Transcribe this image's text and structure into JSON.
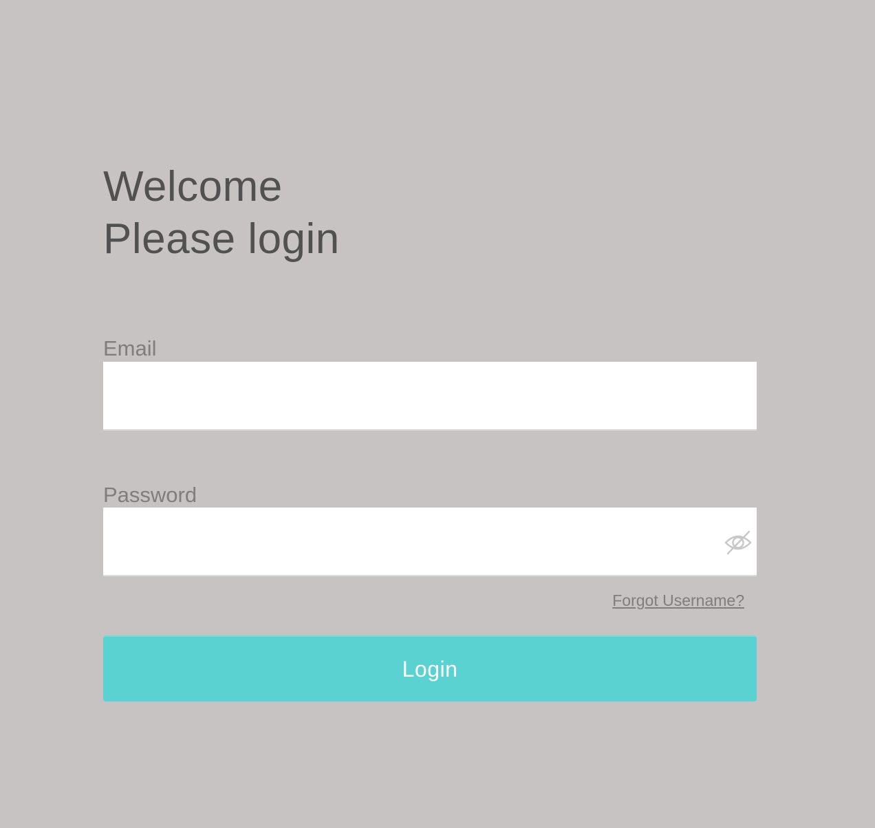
{
  "header": {
    "line1": "Welcome",
    "line2": "Please login"
  },
  "form": {
    "email": {
      "label": "Email",
      "value": "",
      "placeholder": ""
    },
    "password": {
      "label": "Password",
      "value": "",
      "placeholder": "",
      "toggle_icon": "eye-slash-icon"
    },
    "forgot_username_label": "Forgot Username?",
    "login_label": "Login"
  },
  "colors": {
    "background": "#c6c3c2",
    "heading_text": "#525151",
    "label_text": "#7f7e7d",
    "accent": "#5bd2d2",
    "button_text": "#ffffff"
  }
}
